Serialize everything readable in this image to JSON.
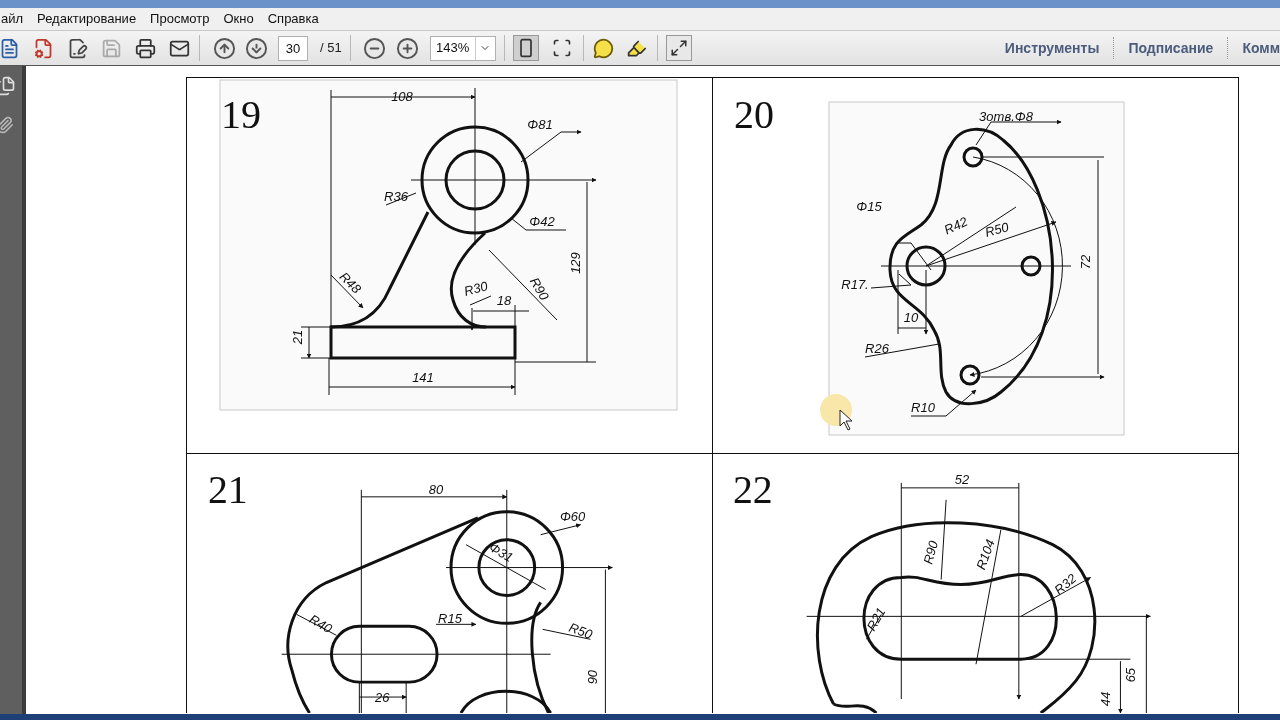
{
  "menu": [
    {
      "label": "айл"
    },
    {
      "label": "Редактирование"
    },
    {
      "label": "Просмотр"
    },
    {
      "label": "Окно"
    },
    {
      "label": "Справка"
    }
  ],
  "toolbar": {
    "file_tools": [
      {
        "kind": "create",
        "disabled": false
      },
      {
        "kind": "convert",
        "disabled": false
      },
      {
        "kind": "edit",
        "disabled": false
      },
      {
        "kind": "save",
        "disabled": true
      },
      {
        "kind": "print",
        "disabled": false
      },
      {
        "kind": "mail",
        "disabled": false
      }
    ],
    "page_field": {
      "value": "30"
    },
    "page_count": "/ 51",
    "zoom_field": {
      "value": "143%"
    },
    "view_tools": [
      {
        "kind": "fit-page",
        "selected": true
      },
      {
        "kind": "fit-width",
        "selected": false
      }
    ],
    "panel_tabs": [
      {
        "label": "Инструменты"
      },
      {
        "label": "Подписание"
      },
      {
        "label": "Комм"
      }
    ]
  },
  "exercises": [
    {
      "number": "19",
      "labels": [
        "108",
        "Φ81",
        "R36",
        "Φ42",
        "129",
        "R48",
        "R30",
        "18",
        "R90",
        "21",
        "141"
      ]
    },
    {
      "number": "20",
      "labels": [
        "3отв.Φ8",
        "Φ15",
        "R42",
        "R50",
        "R17.",
        "72",
        "10",
        "R26",
        "R10"
      ]
    },
    {
      "number": "21",
      "labels": [
        "80",
        "Φ60",
        "Φ31",
        "R40",
        "R15",
        "R50",
        "90",
        "26"
      ]
    },
    {
      "number": "22",
      "labels": [
        "52",
        "R90",
        "R104",
        "R32",
        "R21",
        "65",
        "44"
      ]
    }
  ]
}
